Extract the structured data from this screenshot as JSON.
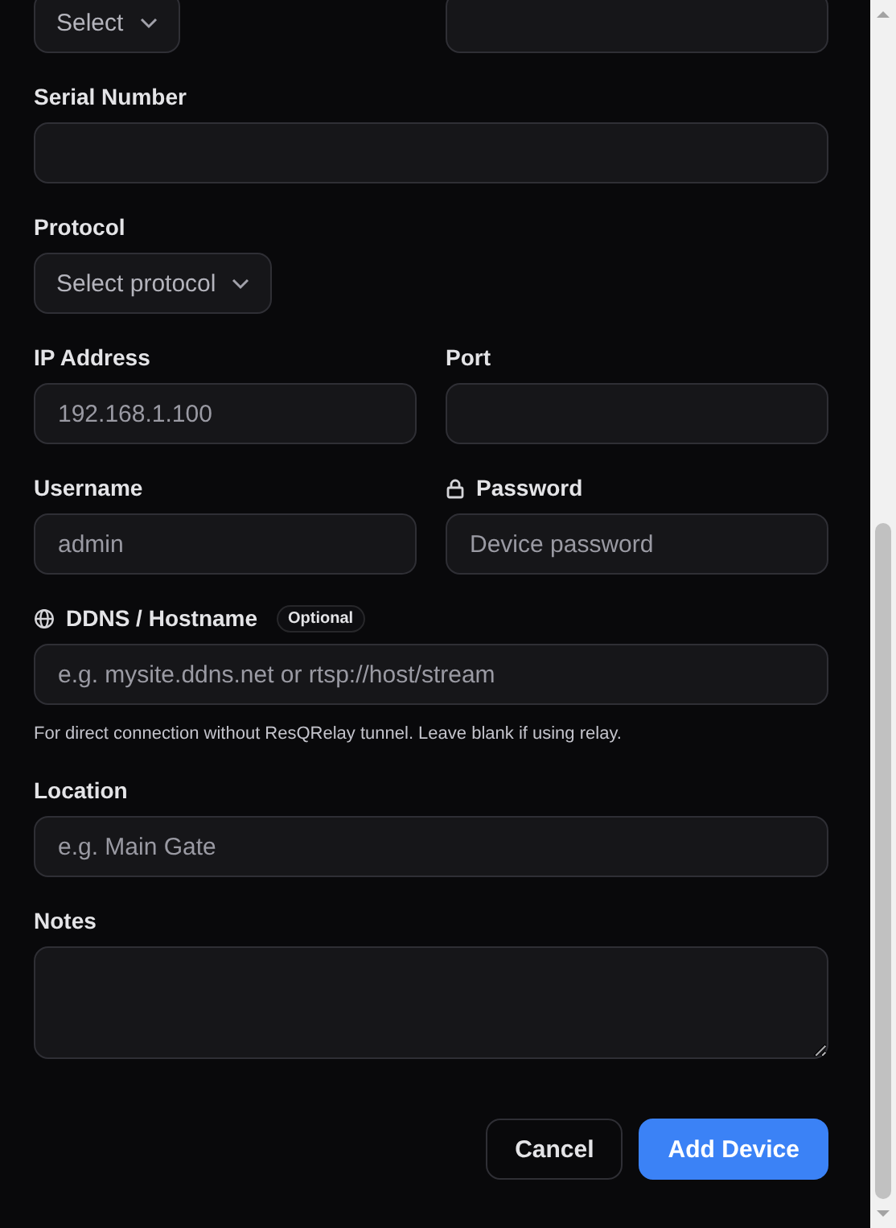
{
  "form": {
    "rows": [
      {
        "fields": [
          {
            "kind": "select",
            "placeholder": "Select"
          },
          {
            "kind": "text"
          }
        ]
      },
      {
        "fields": [
          {
            "kind": "text",
            "label": "Serial Number"
          }
        ]
      },
      {
        "fields": [
          {
            "kind": "select",
            "label": "Protocol",
            "placeholder": "Select protocol"
          }
        ]
      },
      {
        "fields": [
          {
            "kind": "text",
            "label": "IP Address",
            "placeholder": "192.168.1.100"
          },
          {
            "kind": "text",
            "label": "Port"
          }
        ]
      },
      {
        "fields": [
          {
            "kind": "text",
            "label": "Username",
            "placeholder": "admin"
          },
          {
            "kind": "password",
            "label": "Password",
            "placeholder": "Device password"
          }
        ]
      },
      {
        "fields": [
          {
            "kind": "hostname",
            "label": "DDNS / Hostname",
            "badge": "Optional",
            "placeholder": "e.g. mysite.ddns.net or rtsp://host/stream",
            "help": "For direct connection without ResQRelay tunnel. Leave blank if using relay."
          }
        ]
      },
      {
        "fields": [
          {
            "kind": "text",
            "label": "Location",
            "placeholder": "e.g. Main Gate"
          }
        ]
      },
      {
        "fields": [
          {
            "kind": "textarea",
            "label": "Notes"
          }
        ]
      }
    ],
    "buttons": [
      {
        "kind": "secondary",
        "label": "Cancel"
      },
      {
        "kind": "primary",
        "label": "Add Device"
      }
    ]
  }
}
